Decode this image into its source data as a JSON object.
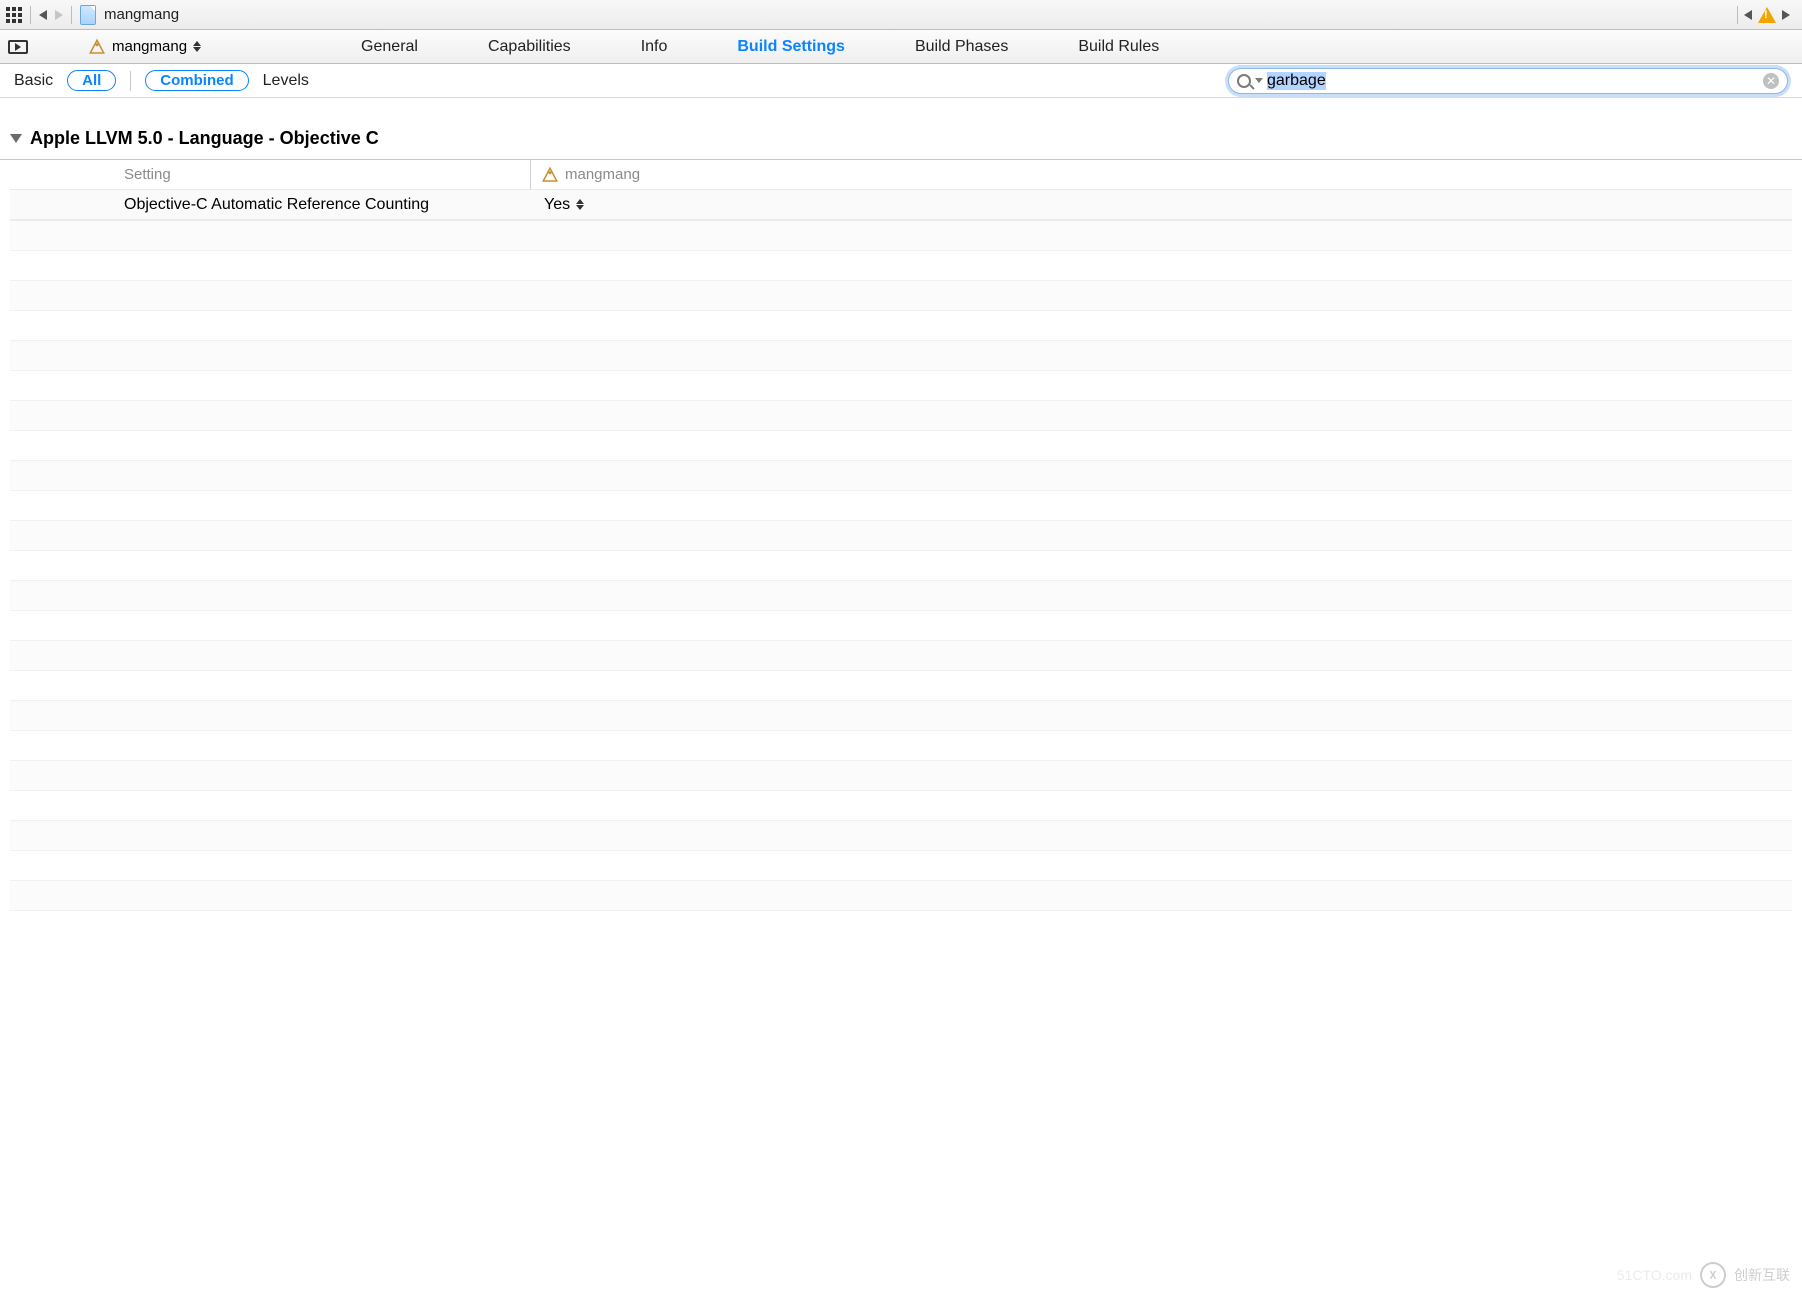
{
  "breadcrumb": {
    "title": "mangmang"
  },
  "target_selector": {
    "name": "mangmang"
  },
  "tabs": [
    {
      "label": "General",
      "active": false
    },
    {
      "label": "Capabilities",
      "active": false
    },
    {
      "label": "Info",
      "active": false
    },
    {
      "label": "Build Settings",
      "active": true
    },
    {
      "label": "Build Phases",
      "active": false
    },
    {
      "label": "Build Rules",
      "active": false
    }
  ],
  "filters": {
    "basic": "Basic",
    "all": "All",
    "combined": "Combined",
    "levels": "Levels"
  },
  "search": {
    "value": "garbage"
  },
  "section": {
    "title": "Apple LLVM 5.0 - Language - Objective C",
    "columns": {
      "setting": "Setting",
      "target": "mangmang"
    },
    "rows": [
      {
        "name": "Objective-C Automatic Reference Counting",
        "value": "Yes"
      }
    ]
  },
  "watermark": {
    "faint": "51CTO.com",
    "text": "创新互联"
  }
}
